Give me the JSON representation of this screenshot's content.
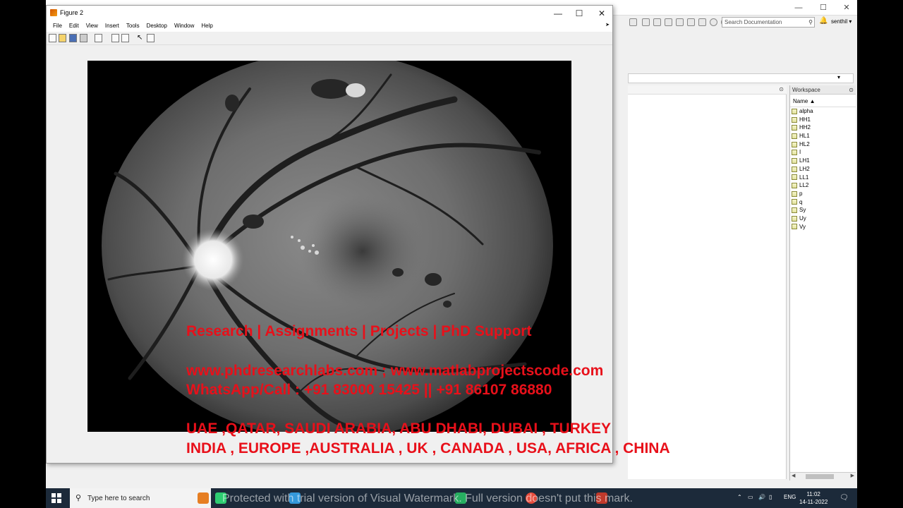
{
  "figure": {
    "title": "Figure 2",
    "menu": [
      "File",
      "Edit",
      "View",
      "Insert",
      "Tools",
      "Desktop",
      "Window",
      "Help"
    ]
  },
  "matlab": {
    "search_placeholder": "Search Documentation",
    "user": "senthil"
  },
  "workspace": {
    "title": "Workspace",
    "column": "Name ▲",
    "variables": [
      "alpha",
      "HH1",
      "HH2",
      "HL1",
      "HL2",
      "I",
      "LH1",
      "LH2",
      "LL1",
      "LL2",
      "p",
      "q",
      "Sy",
      "Uy",
      "Vy"
    ]
  },
  "overlay": {
    "line1": "Research | Assignments | Projects | PhD Support",
    "line2": "www.phdresearchlabs.com ; www.matlabprojectscode.com",
    "line3": "WhatsApp/Call : +91 83000 15425 || +91 86107 86880",
    "line4": "UAE ,QATAR, SAUDI ARABIA, ABU DHABI, DUBAI , TURKEY",
    "line5": "INDIA , EUROPE ,AUSTRALIA , UK , CANADA , USA, AFRICA , CHINA"
  },
  "taskbar": {
    "search_placeholder": "Type here to search",
    "watermark": "Protected with trial version of Visual Watermark. Full version doesn't put this mark.",
    "lang": "ENG",
    "time": "11:02",
    "date": "14-11-2022"
  }
}
